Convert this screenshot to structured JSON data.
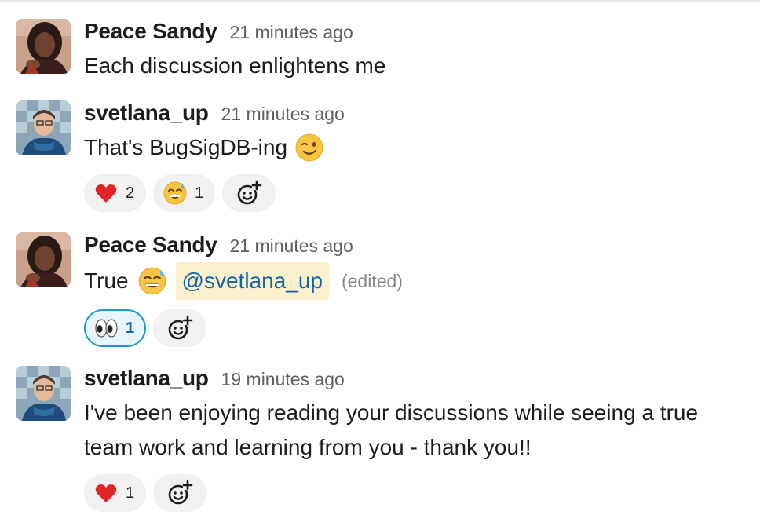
{
  "messages": [
    {
      "author": "Peace Sandy",
      "timestamp": "21 minutes ago",
      "avatar": "avatar-peace-sandy",
      "lines": [
        "Each discussion enlightens me"
      ]
    },
    {
      "author": "svetlana_up",
      "timestamp": "21 minutes ago",
      "avatar": "avatar-svetlana-up",
      "text": "That's BugSigDB-ing",
      "inline_emoji": "winking-face-emoji",
      "reactions": [
        {
          "emoji": "red-heart-emoji",
          "count": "2"
        },
        {
          "emoji": "grinning-sweat-emoji",
          "count": "1"
        }
      ],
      "add_reaction_icon": "add-reaction-icon"
    },
    {
      "author": "Peace Sandy",
      "timestamp": "21 minutes ago",
      "avatar": "avatar-peace-sandy",
      "text": "True",
      "inline_emoji": "grinning-sweat-emoji",
      "mention": "@svetlana_up",
      "edited": "(edited)",
      "reactions": [
        {
          "emoji": "eyes-emoji",
          "count": "1",
          "selected": true
        }
      ],
      "add_reaction_icon": "add-reaction-icon"
    },
    {
      "author": "svetlana_up",
      "timestamp": "19 minutes ago",
      "avatar": "avatar-svetlana-up",
      "lines": [
        "I've been enjoying reading your discussions while seeing a true",
        "team work and learning from you - thank you!!"
      ],
      "reactions": [
        {
          "emoji": "red-heart-emoji",
          "count": "1"
        }
      ],
      "add_reaction_icon": "add-reaction-icon"
    }
  ],
  "colors": {
    "text": "#1d1c1d",
    "timestamp": "#616061",
    "mention_bg": "#fbf0cd",
    "mention_text": "#1264a3",
    "reaction_bg": "#f1f1f1",
    "reaction_selected_border": "#1d9bd1"
  }
}
